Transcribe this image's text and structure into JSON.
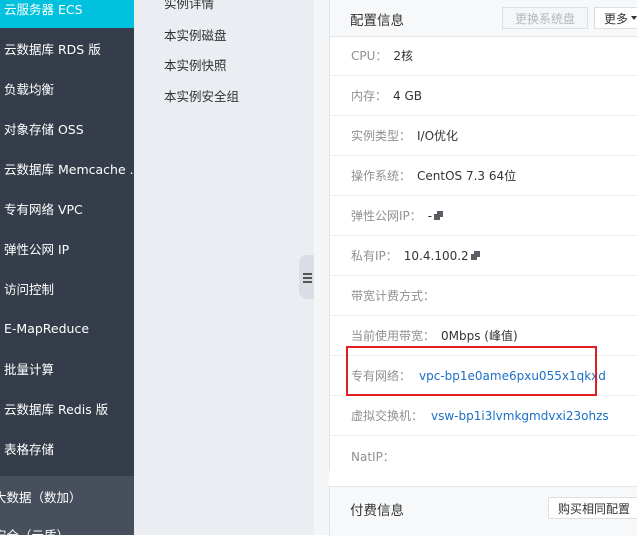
{
  "nav": {
    "items": [
      {
        "label": "云服务器 ECS",
        "active": true
      },
      {
        "label": "云数据库 RDS 版"
      },
      {
        "label": "负载均衡"
      },
      {
        "label": "对象存储 OSS"
      },
      {
        "label": "云数据库 Memcache ..."
      },
      {
        "label": "专有网络 VPC"
      },
      {
        "label": "弹性公网 IP"
      },
      {
        "label": "访问控制"
      },
      {
        "label": "E-MapReduce"
      },
      {
        "label": "批量计算"
      },
      {
        "label": "云数据库 Redis 版"
      },
      {
        "label": "表格存储"
      }
    ],
    "section_items": [
      {
        "label": "大数据（数加）"
      },
      {
        "label": "安全（云盾）"
      }
    ],
    "colors": {
      "background": "#363d4a",
      "active": "#00c1de"
    }
  },
  "submenu": {
    "items": [
      {
        "label": "实例详情"
      },
      {
        "label": "本实例磁盘"
      },
      {
        "label": "本实例快照"
      },
      {
        "label": "本实例安全组"
      }
    ]
  },
  "config": {
    "title": "配置信息",
    "buttons": {
      "change_disk": "更换系统盘",
      "more": "更多"
    },
    "rows": [
      {
        "label": "CPU：",
        "value": "2核"
      },
      {
        "label": "内存：",
        "value": "4 GB"
      },
      {
        "label": "实例类型：",
        "value": "I/O优化"
      },
      {
        "label": "操作系统：",
        "value": "CentOS 7.3 64位"
      },
      {
        "label": "弹性公网IP：",
        "value": "-"
      },
      {
        "label": "私有IP：",
        "value": "10.4.100.2"
      },
      {
        "label": "带宽计费方式：",
        "value": ""
      },
      {
        "label": "当前使用带宽：",
        "value": "0Mbps (峰值)"
      },
      {
        "label": "专有网络：",
        "value": "vpc-bp1e0ame6pxu055x1qkxd"
      },
      {
        "label": "虚拟交换机：",
        "value": "vsw-bp1i3lvmkgmdvxi23ohzs"
      },
      {
        "label": "NatIP：",
        "value": ""
      }
    ],
    "link_color": "#1a6fc8",
    "highlight_color": "#e21e25"
  },
  "billing": {
    "title": "付费信息",
    "button": "购买相同配置"
  }
}
